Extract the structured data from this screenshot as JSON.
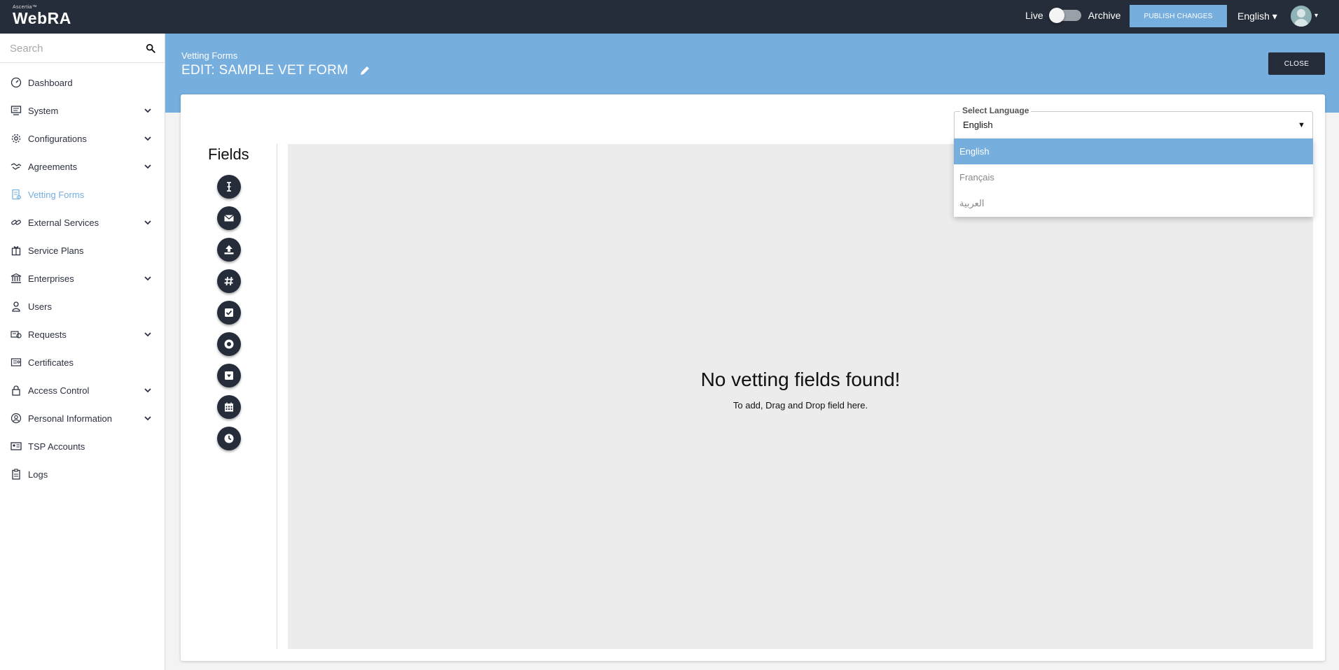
{
  "topbar": {
    "brand_small": "Ascertia™",
    "brand_main": "WebRA",
    "live_label": "Live",
    "archive_label": "Archive",
    "publish_label": "PUBLISH CHANGES",
    "language": "English ▾",
    "avatar_caret": "▾"
  },
  "sidebar": {
    "search_placeholder": "Search",
    "items": [
      {
        "label": "Dashboard",
        "icon": "gauge-icon",
        "expandable": false
      },
      {
        "label": "System",
        "icon": "monitor-icon",
        "expandable": true
      },
      {
        "label": "Configurations",
        "icon": "gear-icon",
        "expandable": true
      },
      {
        "label": "Agreements",
        "icon": "handshake-icon",
        "expandable": true
      },
      {
        "label": "Vetting Forms",
        "icon": "form-icon",
        "expandable": false,
        "active": true
      },
      {
        "label": "External Services",
        "icon": "link-icon",
        "expandable": true
      },
      {
        "label": "Service Plans",
        "icon": "gift-icon",
        "expandable": false
      },
      {
        "label": "Enterprises",
        "icon": "bank-icon",
        "expandable": true
      },
      {
        "label": "Users",
        "icon": "user-icon",
        "expandable": false
      },
      {
        "label": "Requests",
        "icon": "requests-icon",
        "expandable": true
      },
      {
        "label": "Certificates",
        "icon": "certificate-icon",
        "expandable": false
      },
      {
        "label": "Access Control",
        "icon": "lock-icon",
        "expandable": true
      },
      {
        "label": "Personal Information",
        "icon": "person-circle-icon",
        "expandable": true
      },
      {
        "label": "TSP Accounts",
        "icon": "id-card-icon",
        "expandable": false
      },
      {
        "label": "Logs",
        "icon": "clipboard-icon",
        "expandable": false
      }
    ]
  },
  "header": {
    "breadcrumb": "Vetting Forms",
    "title": "EDIT: SAMPLE VET FORM",
    "close_label": "CLOSE"
  },
  "fields": {
    "title": "Fields",
    "tools": [
      "text-cursor-icon",
      "envelope-icon",
      "upload-icon",
      "hash-icon",
      "checkbox-icon",
      "radio-icon",
      "dropdown-icon",
      "calendar-icon",
      "clock-icon"
    ]
  },
  "dropzone": {
    "empty_title": "No vetting fields found!",
    "empty_sub": "To add, Drag and Drop field here."
  },
  "language_select": {
    "label": "Select Language",
    "value": "English",
    "caret": "▼",
    "options": [
      "English",
      "Français",
      "العربية"
    ],
    "selected_index": 0
  },
  "colors": {
    "topbar": "#252c3a",
    "accent": "#76aede",
    "dropzone": "#ececec"
  }
}
